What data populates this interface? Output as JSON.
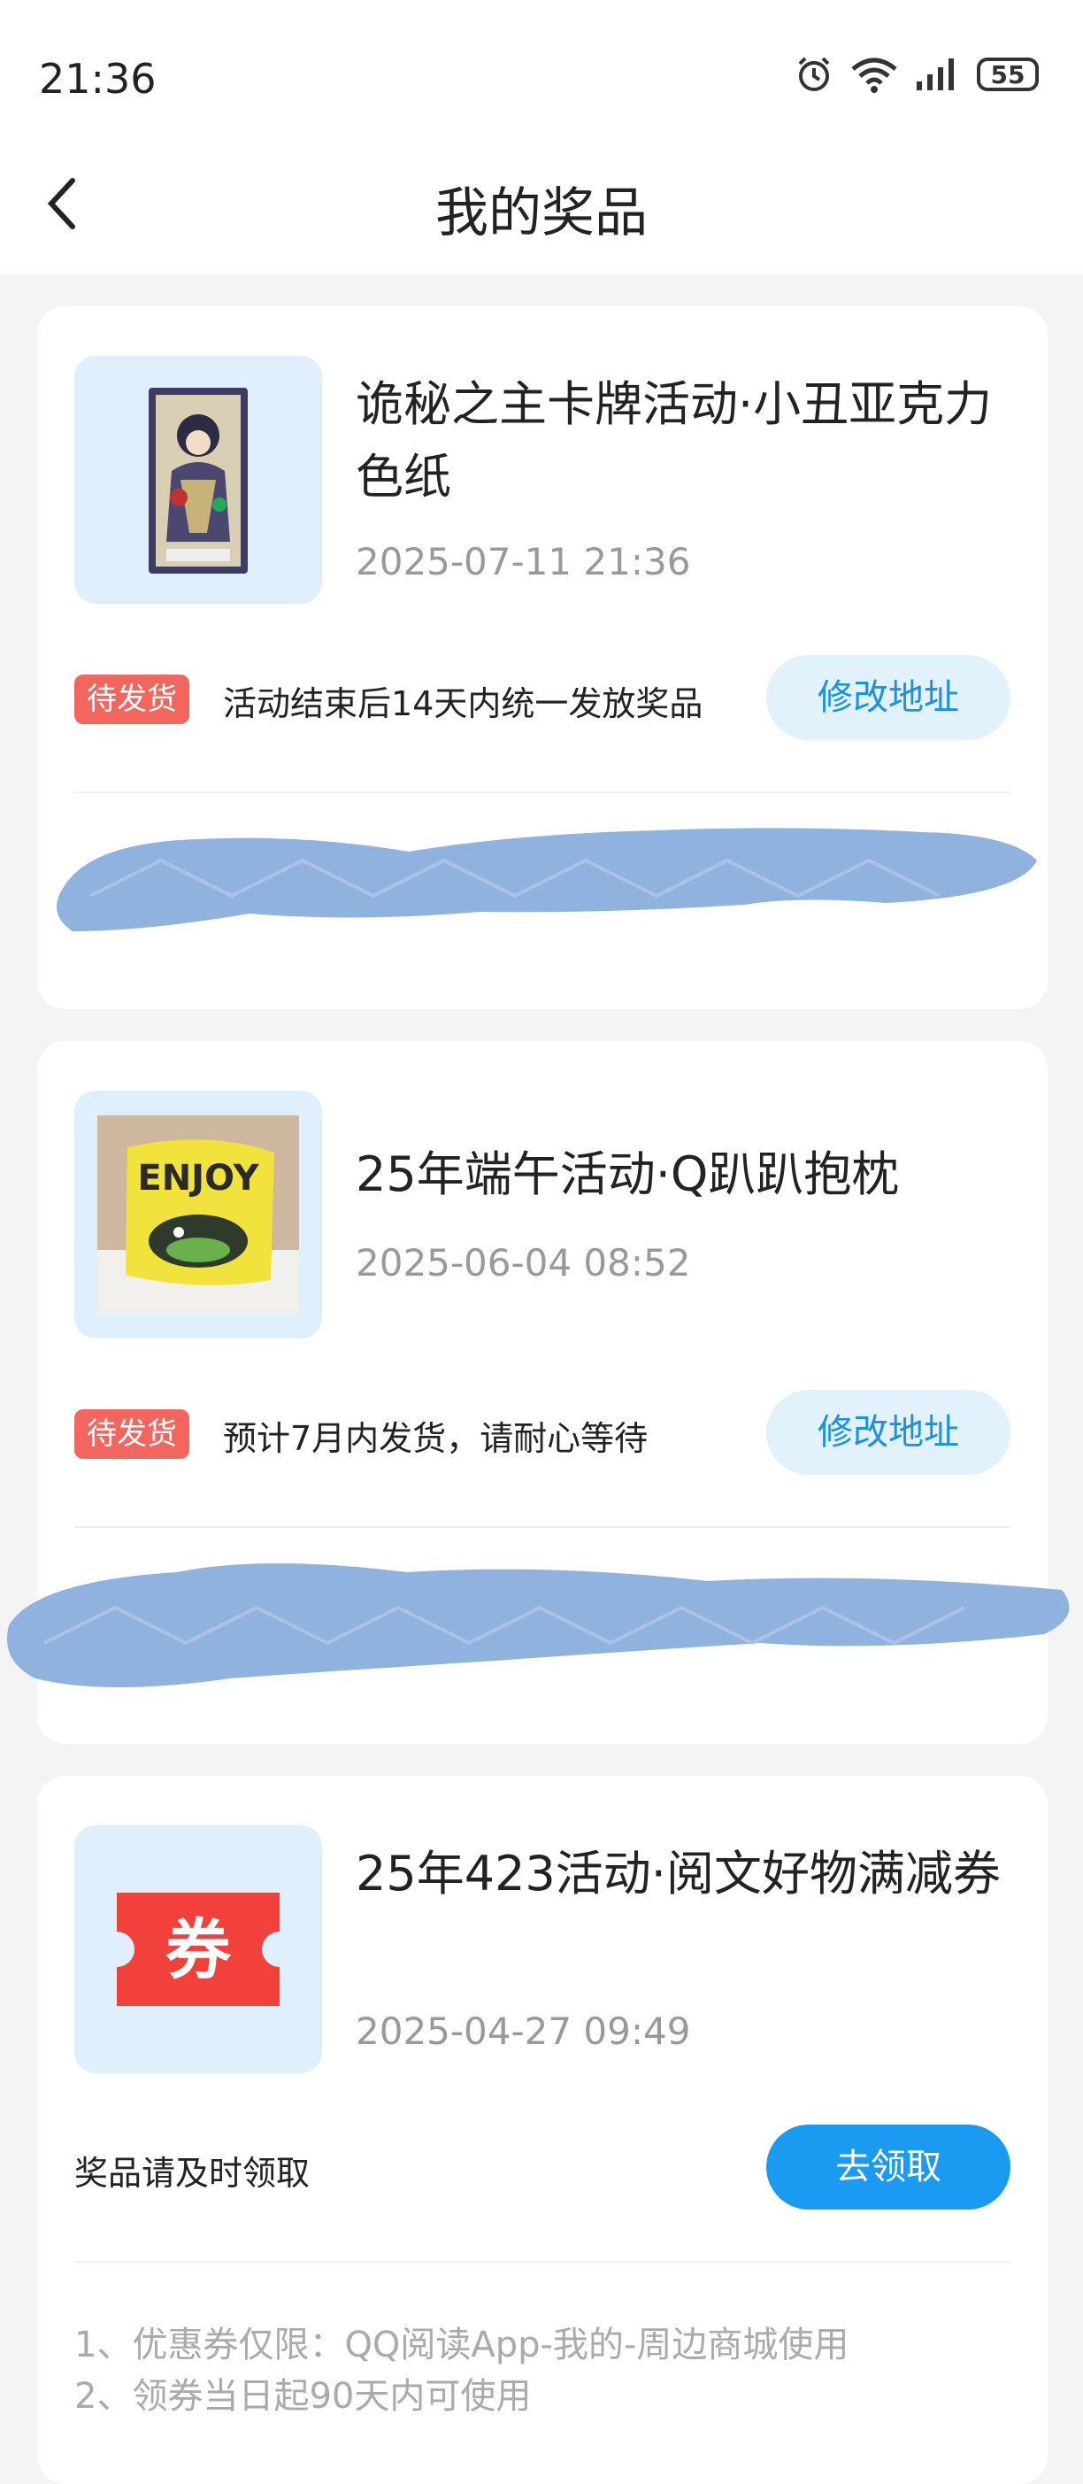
{
  "status_bar": {
    "time": "21:36",
    "battery": "55"
  },
  "header": {
    "title": "我的奖品"
  },
  "prizes": [
    {
      "title": "诡秘之主卡牌活动·小丑亚克力色纸",
      "date": "2025-07-11 21:36",
      "status": "待发货",
      "notice": "活动结束后14天内统一发放奖品",
      "action": "修改地址"
    },
    {
      "title": "25年端午活动·Q趴趴抱枕",
      "date": "2025-06-04 08:52",
      "status": "待发货",
      "notice": "预计7月内发货，请耐心等待",
      "action": "修改地址",
      "pillow_text": "ENJOY"
    },
    {
      "title": "25年423活动·阅文好物满减券",
      "date": "2025-04-27 09:49",
      "notice": "奖品请及时领取",
      "action": "去领取",
      "coupon_char": "券",
      "info": [
        "1、优惠券仅限：QQ阅读App-我的-周边商城使用",
        "2、领券当日起90天内可使用"
      ]
    }
  ],
  "colors": {
    "accent": "#1a9af0",
    "badge": "#f2665d",
    "thumb_bg": "#dff0fc"
  }
}
